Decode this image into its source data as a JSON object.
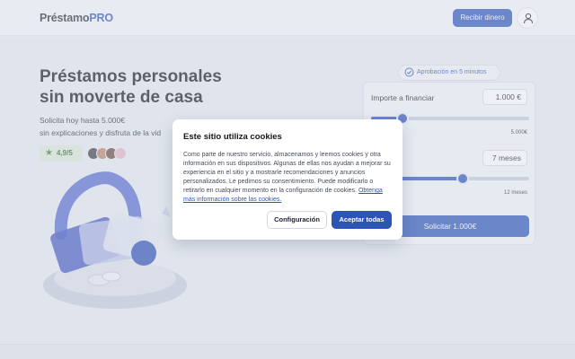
{
  "header": {
    "logo_main": "Préstamo",
    "logo_accent": "PRO",
    "cta_label": "Recibir dinero",
    "user_icon": "user-icon"
  },
  "hero": {
    "title_line1": "Préstamos personales",
    "title_line2": "sin moverte de casa",
    "subtitle_line1": "Solicita hoy hasta 5.000€",
    "subtitle_line2": "sin explicaciones y disfruta de la vid",
    "rating": "4,9/5",
    "rating_icon": "star-icon"
  },
  "calculator": {
    "badge": "Aprobación en 5 minutos",
    "amount_label": "Importe a financiar",
    "amount_value": "1.000  €",
    "amount_max": "5.000€",
    "amount_fraction": 0.2,
    "months_value": "7  meses",
    "months_max": "12 meses",
    "months_fraction": 0.58,
    "submit_label": "Solicitar  1.000€"
  },
  "cookie_modal": {
    "title": "Este sitio utiliza cookies",
    "body": "Como parte de nuestro servicio, almacenamos y leemos cookies y otra información en sus dispositivos. Algunas de ellas nos ayudan a mejorar su experiencia en el sitio y a mostrarle recomendaciones y anuncios personalizados. Le pedimos su consentimiento. Puede modificarlo o retirarlo en cualquier momento en la configuración de cookies.",
    "link": "Obtenga más información sobre las cookies.",
    "config_label": "Configuración",
    "accept_label": "Aceptar todas"
  },
  "colors": {
    "brand": "#2d55b8",
    "rating_green": "#3b8b3a"
  }
}
